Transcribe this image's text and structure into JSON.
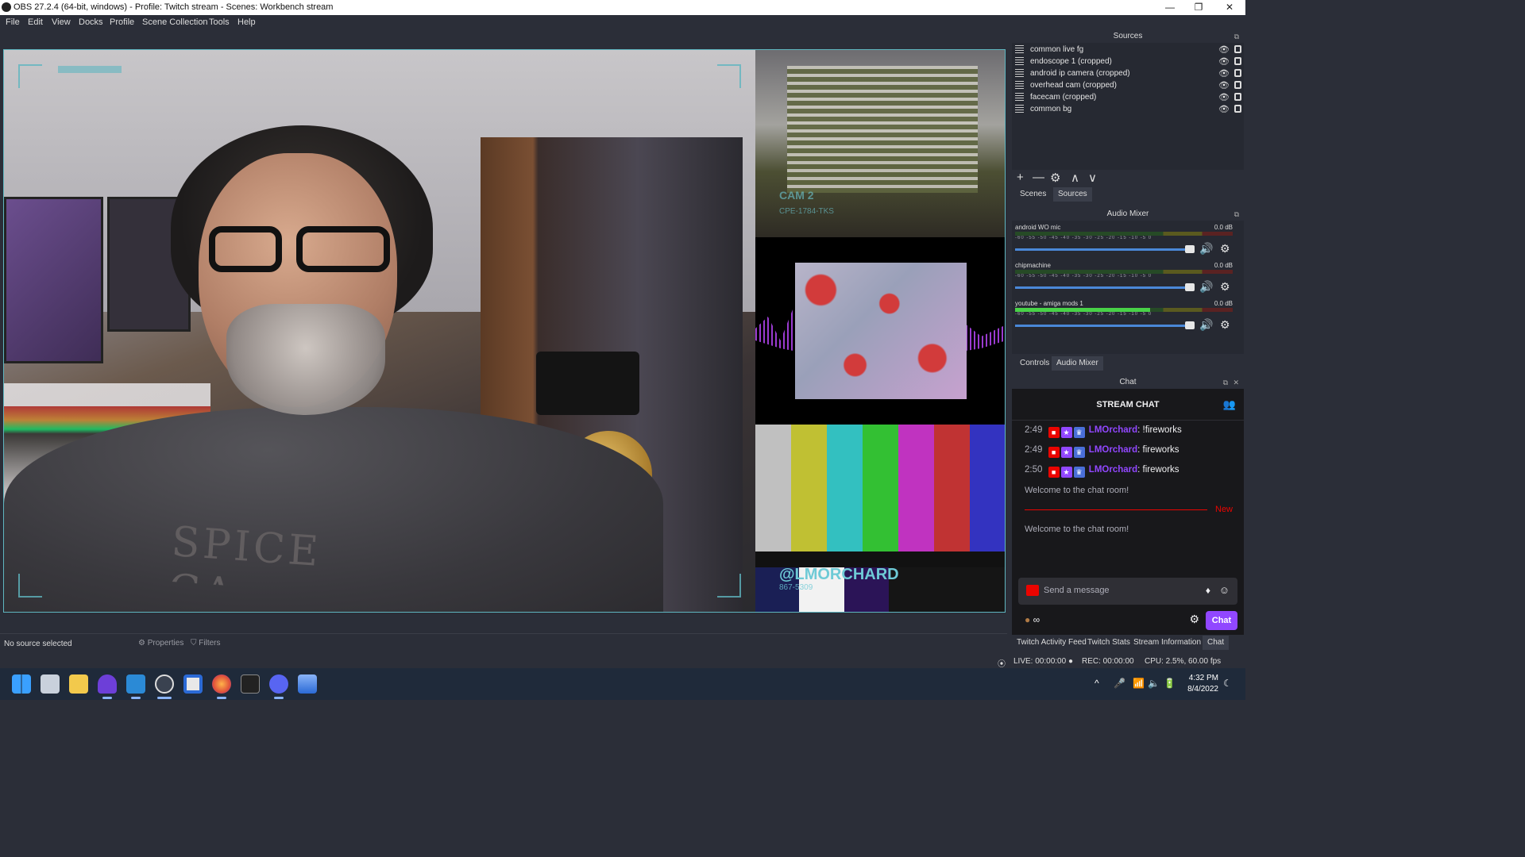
{
  "window": {
    "title": "OBS 27.2.4 (64-bit, windows) - Profile: Twitch stream - Scenes: Workbench stream",
    "minimize": "—",
    "maximize": "❐",
    "close": "✕"
  },
  "menu": [
    "File",
    "Edit",
    "View",
    "Docks",
    "Profile",
    "Scene Collection",
    "Tools",
    "Help"
  ],
  "preview": {
    "room_overlay_line1": "CAM 2",
    "room_overlay_line2": "CPE-1784-TKS",
    "shirt_text": "SPICE CA",
    "handle_overlay": "@LMORCHARD",
    "handle_sub": "867-5309",
    "bars_colors": [
      "#c0c0c0",
      "#c0c033",
      "#33c0c0",
      "#33c033",
      "#c033c0",
      "#c03333",
      "#3333c0"
    ]
  },
  "source_status": {
    "text": "No source selected",
    "properties": "Properties",
    "filters": "Filters"
  },
  "sources": {
    "title": "Sources",
    "items": [
      {
        "name": "common live fg"
      },
      {
        "name": "endoscope 1 (cropped)"
      },
      {
        "name": "android ip camera (cropped)"
      },
      {
        "name": "overhead cam (cropped)"
      },
      {
        "name": "facecam (cropped)"
      },
      {
        "name": "common bg"
      }
    ],
    "toolbar": [
      "+",
      "—",
      "⚙",
      "∧",
      "∨"
    ]
  },
  "scene_tabs": [
    "Scenes",
    "Sources"
  ],
  "audio_mixer": {
    "title": "Audio Mixer",
    "scale": "-60 -55 -50 -45 -40 -35 -30 -25 -20 -15 -10 -5 0",
    "channels": [
      {
        "name": "android WO mic",
        "db": "0.0 dB",
        "level": 0.0
      },
      {
        "name": "chipmachine",
        "db": "0.0 dB",
        "level": 0.0
      },
      {
        "name": "youtube - amiga mods 1",
        "db": "0.0 dB",
        "level": 0.62
      }
    ]
  },
  "control_tabs": [
    "Controls",
    "Audio Mixer"
  ],
  "chat": {
    "dock_title": "Chat",
    "header": "STREAM CHAT",
    "messages": [
      {
        "time": "2:49",
        "user": "LMOrchard",
        "text": ": !fireworks"
      },
      {
        "time": "2:49",
        "user": "LMOrchard",
        "text": ": fireworks"
      },
      {
        "time": "2:50",
        "user": "LMOrchard",
        "text": ": fireworks"
      }
    ],
    "welcome1": "Welcome to the chat room!",
    "new_label": "New",
    "welcome2": "Welcome to the chat room!",
    "input_placeholder": "Send a message",
    "points": "∞",
    "chat_button": "Chat"
  },
  "bottom_tabs": [
    "Twitch Activity Feed",
    "Twitch Stats",
    "Stream Information",
    "Chat"
  ],
  "status": {
    "live": "LIVE: 00:00:00",
    "rec": "REC: 00:00:00",
    "cpu": "CPU: 2.5%, 60.00 fps"
  },
  "taskbar": {
    "time": "4:32 PM",
    "date": "8/4/2022"
  }
}
